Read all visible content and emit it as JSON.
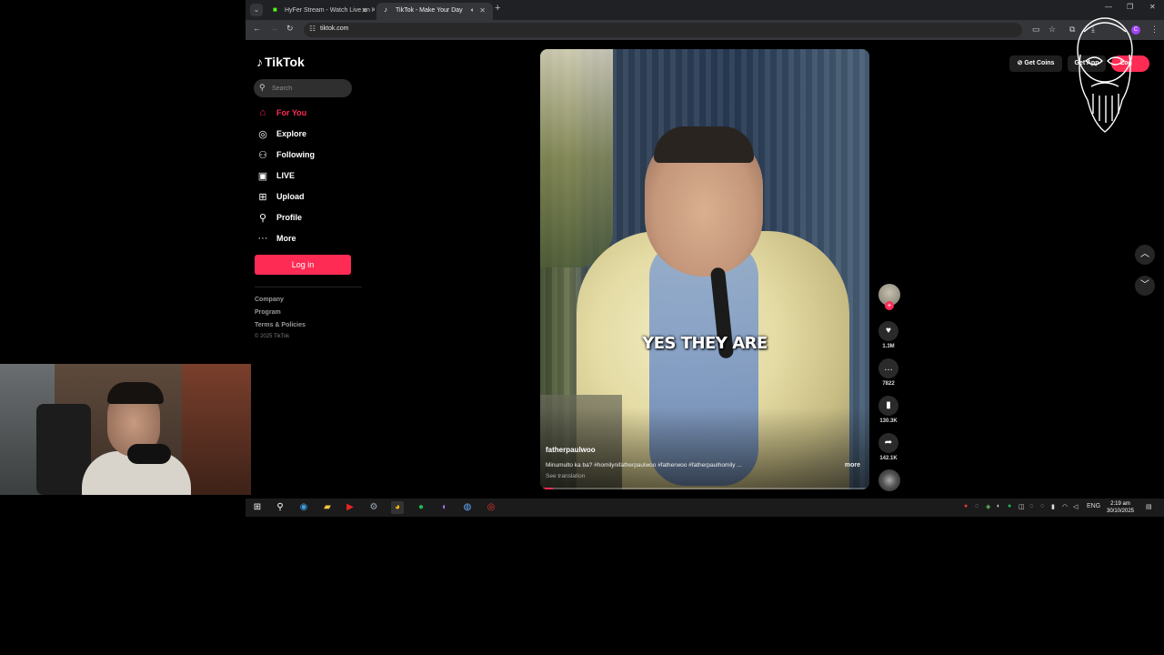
{
  "browser": {
    "tabs": [
      {
        "title": "HyFer Stream - Watch Live on K",
        "active": false
      },
      {
        "title": "TikTok - Make Your Day",
        "active": true
      }
    ],
    "url": "tiktok.com"
  },
  "sidebar": {
    "logo": "TikTok",
    "search_placeholder": "Search",
    "nav": [
      {
        "label": "For You",
        "icon": "home-icon",
        "active": true
      },
      {
        "label": "Explore",
        "icon": "compass-icon",
        "active": false
      },
      {
        "label": "Following",
        "icon": "following-icon",
        "active": false
      },
      {
        "label": "LIVE",
        "icon": "live-icon",
        "active": false
      },
      {
        "label": "Upload",
        "icon": "upload-icon",
        "active": false
      },
      {
        "label": "Profile",
        "icon": "profile-icon",
        "active": false
      },
      {
        "label": "More",
        "icon": "more-icon",
        "active": false
      }
    ],
    "login_label": "Log in",
    "footer_links": [
      "Company",
      "Program",
      "Terms & Policies"
    ],
    "copyright": "© 2025 TikTok"
  },
  "video": {
    "caption_overlay": "YES THEY ARE",
    "author": "fatherpaulwoo",
    "description": "Minumulto ka ba? #homilynifatherpaulwoo #fatherwoo #fatherpaulhomily ...",
    "more_label": "more",
    "see_translation": "See translation",
    "progress": 0.04
  },
  "actions": {
    "likes": "1.3M",
    "comments": "7822",
    "saves": "130.3K",
    "shares": "142.1K"
  },
  "header_buttons": {
    "get_coins": "Get Coins",
    "get_app": "Get App",
    "login": "Log"
  },
  "taskbar": {
    "language": "ENG",
    "time": "2:19 am",
    "date": "30/10/2025"
  },
  "colors": {
    "accent": "#fe2c55",
    "background": "#000000"
  }
}
